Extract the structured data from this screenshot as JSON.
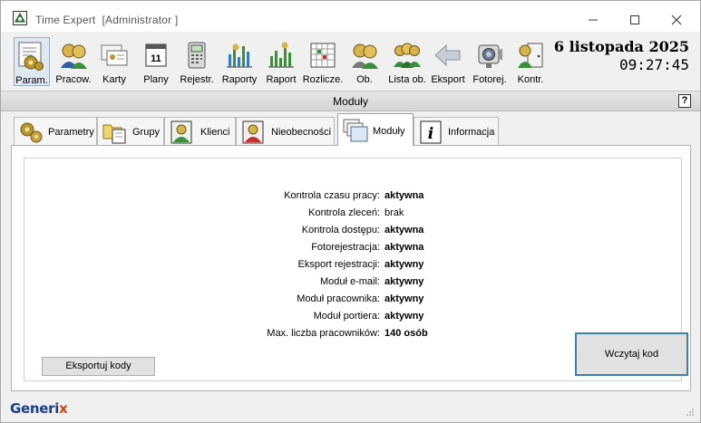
{
  "window": {
    "title": "Time Expert",
    "title_role": "[Administrator ]"
  },
  "toolbar": {
    "items": [
      {
        "label": "Param.",
        "icon": "gears-icon"
      },
      {
        "label": "Pracow.",
        "icon": "people-icon"
      },
      {
        "label": "Karty",
        "icon": "id-cards-icon"
      },
      {
        "label": "Plany",
        "icon": "calendar-icon"
      },
      {
        "label": "Rejestr.",
        "icon": "terminal-icon"
      },
      {
        "label": "Raporty",
        "icon": "bar-chart-icon"
      },
      {
        "label": "Raport",
        "icon": "bar-chart-icon"
      },
      {
        "label": "Rozlicze.",
        "icon": "grid-sheet-icon"
      },
      {
        "label": "Ob.",
        "icon": "people-icon"
      },
      {
        "label": "Lista ob.",
        "icon": "group-icon"
      },
      {
        "label": "Eksport",
        "icon": "arrow-left-icon"
      },
      {
        "label": "Fotorej.",
        "icon": "camera-icon"
      },
      {
        "label": "Kontr.",
        "icon": "door-person-icon"
      }
    ],
    "active_index": 0
  },
  "clock": {
    "date": "6 listopada 2025",
    "time": "09:27:45"
  },
  "section": {
    "title": "Moduły",
    "help": "?"
  },
  "tabs": [
    {
      "label": "Parametry",
      "icon": "gears-icon"
    },
    {
      "label": "Grupy",
      "icon": "folder-document-icon"
    },
    {
      "label": "Klienci",
      "icon": "person-portrait-icon"
    },
    {
      "label": "Nieobecności",
      "icon": "person-red-icon"
    },
    {
      "label": "Moduły",
      "icon": "windows-stack-icon"
    },
    {
      "label": "Informacja",
      "icon": "info-icon"
    }
  ],
  "active_tab": "Moduły",
  "modules": [
    {
      "label": "Kontrola czasu pracy:",
      "value": "aktywna",
      "bold": true
    },
    {
      "label": "Kontrola zleceń:",
      "value": "brak",
      "bold": false
    },
    {
      "label": "Kontrola dostępu:",
      "value": "aktywna",
      "bold": true
    },
    {
      "label": "Fotorejestracja:",
      "value": "aktywna",
      "bold": true
    },
    {
      "label": "Eksport rejestracji:",
      "value": "aktywny",
      "bold": true
    },
    {
      "label": "Moduł e-mail:",
      "value": "aktywny",
      "bold": true
    },
    {
      "label": "Moduł pracownika:",
      "value": "aktywny",
      "bold": true
    },
    {
      "label": "Moduł portiera:",
      "value": "aktywny",
      "bold": true
    },
    {
      "label": "Max. liczba pracowników:",
      "value": "140 osób",
      "bold": true
    }
  ],
  "buttons": {
    "export_codes": "Eksportuj kody",
    "load_code": "Wczytaj kod"
  },
  "footer": {
    "logo_main": "Generi",
    "logo_accent": "x"
  },
  "colors": {
    "accent_blue": "#3c7fb1",
    "logo_blue": "#1c3f86",
    "logo_orange": "#d04a10"
  }
}
